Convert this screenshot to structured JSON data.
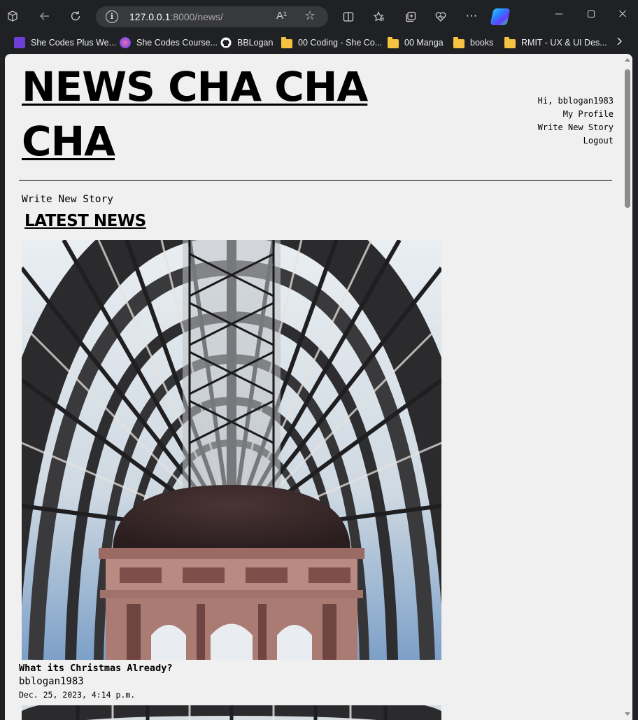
{
  "browser": {
    "url_host": "127.0.0.1",
    "url_rest": ":8000/news/",
    "read_aloud_icon": "A¹",
    "bookmarks": [
      {
        "label": "She Codes Plus We...",
        "icon": "purple-list-icon"
      },
      {
        "label": "She Codes Course...",
        "icon": "shecodes-icon"
      },
      {
        "label": "BBLogan",
        "icon": "github-icon"
      },
      {
        "label": "00 Coding - She Co...",
        "icon": "folder-icon"
      },
      {
        "label": "00 Manga",
        "icon": "folder-icon"
      },
      {
        "label": "books",
        "icon": "folder-icon"
      },
      {
        "label": "RMIT - UX & UI Des...",
        "icon": "folder-icon"
      }
    ]
  },
  "site": {
    "title": "NEWS CHA CHA CHA"
  },
  "nav": {
    "greeting": "Hi, bblogan1983",
    "profile": "My Profile",
    "write": "Write New Story",
    "logout": "Logout"
  },
  "page": {
    "write_link": "Write New Story",
    "section_heading": "LATEST NEWS"
  },
  "stories": [
    {
      "title": "What its Christmas Already?",
      "author": "bblogan1983",
      "date": "Dec. 25, 2023, 4:14 p.m."
    }
  ]
}
